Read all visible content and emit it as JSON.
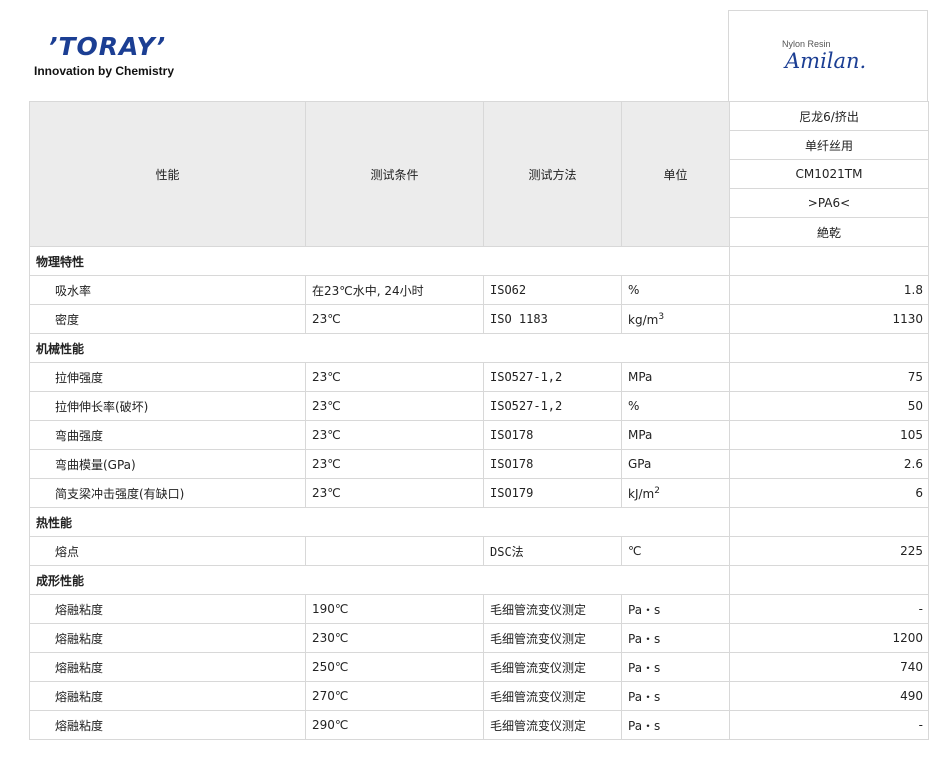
{
  "header": {
    "logo_word": "’TORAY’",
    "logo_tagline": "Innovation by Chemistry",
    "brand_subtitle": "Nylon Resin",
    "brand_name": "Amilan."
  },
  "table": {
    "columns": {
      "property": "性能",
      "condition": "测试条件",
      "method": "测试方法",
      "unit": "单位"
    },
    "grade_info": [
      "尼龙6/挤出",
      "单纤丝用",
      "CM1021TM",
      ">PA6<",
      "絶乾"
    ],
    "sections": [
      {
        "name": "物理特性",
        "rows": [
          {
            "property": "吸水率",
            "condition": "在23℃水中, 24小时",
            "method": "ISO62",
            "unit": "%",
            "value": "1.8"
          },
          {
            "property": "密度",
            "condition": "23℃",
            "method": "ISO 1183",
            "unit": "kg/m",
            "unit_sup": "3",
            "value": "1130"
          }
        ]
      },
      {
        "name": "机械性能",
        "rows": [
          {
            "property": "拉伸强度",
            "condition": "23℃",
            "method": "ISO527-1,2",
            "unit": "MPa",
            "value": "75"
          },
          {
            "property": "拉伸伸长率(破坏)",
            "condition": "23℃",
            "method": "ISO527-1,2",
            "unit": "%",
            "value": "50"
          },
          {
            "property": "弯曲强度",
            "condition": "23℃",
            "method": "ISO178",
            "unit": "MPa",
            "value": "105"
          },
          {
            "property": "弯曲模量(GPa)",
            "condition": "23℃",
            "method": "ISO178",
            "unit": "GPa",
            "value": "2.6"
          },
          {
            "property": "简支梁冲击强度(有缺口)",
            "condition": "23℃",
            "method": "ISO179",
            "unit": "kJ/m",
            "unit_sup": "2",
            "value": "6"
          }
        ]
      },
      {
        "name": "热性能",
        "rows": [
          {
            "property": "熔点",
            "condition": "",
            "method": "DSC法",
            "unit": "℃",
            "value": "225"
          }
        ]
      },
      {
        "name": "成形性能",
        "rows": [
          {
            "property": "熔融粘度",
            "condition": "190℃",
            "method": "毛细管流变仪测定",
            "unit": "Pa・s",
            "value": "-"
          },
          {
            "property": "熔融粘度",
            "condition": "230℃",
            "method": "毛细管流变仪测定",
            "unit": "Pa・s",
            "value": "1200"
          },
          {
            "property": "熔融粘度",
            "condition": "250℃",
            "method": "毛细管流变仪测定",
            "unit": "Pa・s",
            "value": "740"
          },
          {
            "property": "熔融粘度",
            "condition": "270℃",
            "method": "毛细管流变仪测定",
            "unit": "Pa・s",
            "value": "490"
          },
          {
            "property": "熔融粘度",
            "condition": "290℃",
            "method": "毛细管流变仪测定",
            "unit": "Pa・s",
            "value": "-"
          }
        ]
      }
    ]
  },
  "colors": {
    "brand_blue": "#1b3e93",
    "header_bg": "#ececec",
    "grid_line": "#d8d8d8"
  }
}
